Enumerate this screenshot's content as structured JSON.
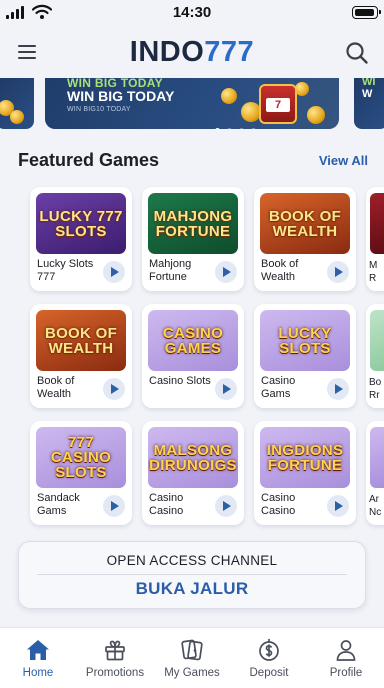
{
  "status_bar": {
    "time": "14:30"
  },
  "header": {
    "logo_part1": "INDO",
    "logo_part2": "777"
  },
  "banner": {
    "line1": "WIN BIG TODAY",
    "line2": "WIN BIG TODAY",
    "line3": "WIN BIG10 TODAY",
    "right_peek_1": "WI",
    "right_peek_2": "W",
    "active_dot": 1,
    "dot_count": 4
  },
  "featured": {
    "title": "Featured Games",
    "view_all": "View All",
    "games": [
      {
        "thumb": "LUCKY 777 SLOTS",
        "name": "Lucky Slots 777",
        "theme": "purple"
      },
      {
        "thumb": "MAHJONG FORTUNE",
        "name": "Mahjong Fortune",
        "theme": "green"
      },
      {
        "thumb": "BOOK OF WEALTH",
        "name": "Book of Wealth",
        "theme": "orange"
      },
      {
        "thumb": "BOOK OF WEALTH",
        "name": "Book of Wealth",
        "theme": "orange"
      },
      {
        "thumb": "CASINO GAMES",
        "name": "Casino Slots",
        "theme": "lilac"
      },
      {
        "thumb": "LUCKY SLOTS",
        "name": "Casino Gams",
        "theme": "lilac"
      },
      {
        "thumb": "777 CASINO SLOTS",
        "name": "Sandack Gams",
        "theme": "lilac"
      },
      {
        "thumb": "MALSONG DIRUNOIGS",
        "name": "Casino Casino",
        "theme": "lilac"
      },
      {
        "thumb": "INGDIONS FORTUNE",
        "name": "Casino Casino",
        "theme": "lilac"
      }
    ],
    "edge_peeks": [
      "M\nR",
      "Bo\nRr",
      "Ar\nNc"
    ]
  },
  "access": {
    "heading": "OPEN ACCESS CHANNEL",
    "link": "BUKA JALUR"
  },
  "bottom_nav": [
    {
      "label": "Home",
      "icon": "home-icon",
      "active": true
    },
    {
      "label": "Promotions",
      "icon": "gift-icon",
      "active": false
    },
    {
      "label": "My Games",
      "icon": "cards-icon",
      "active": false
    },
    {
      "label": "Deposit",
      "icon": "deposit-icon",
      "active": false
    },
    {
      "label": "Profile",
      "icon": "user-icon",
      "active": false
    }
  ],
  "colors": {
    "accent": "#2a5ea8",
    "brand_dark": "#1c2940",
    "brand_blue": "#2b6cc4",
    "background": "#f1f3f8"
  }
}
